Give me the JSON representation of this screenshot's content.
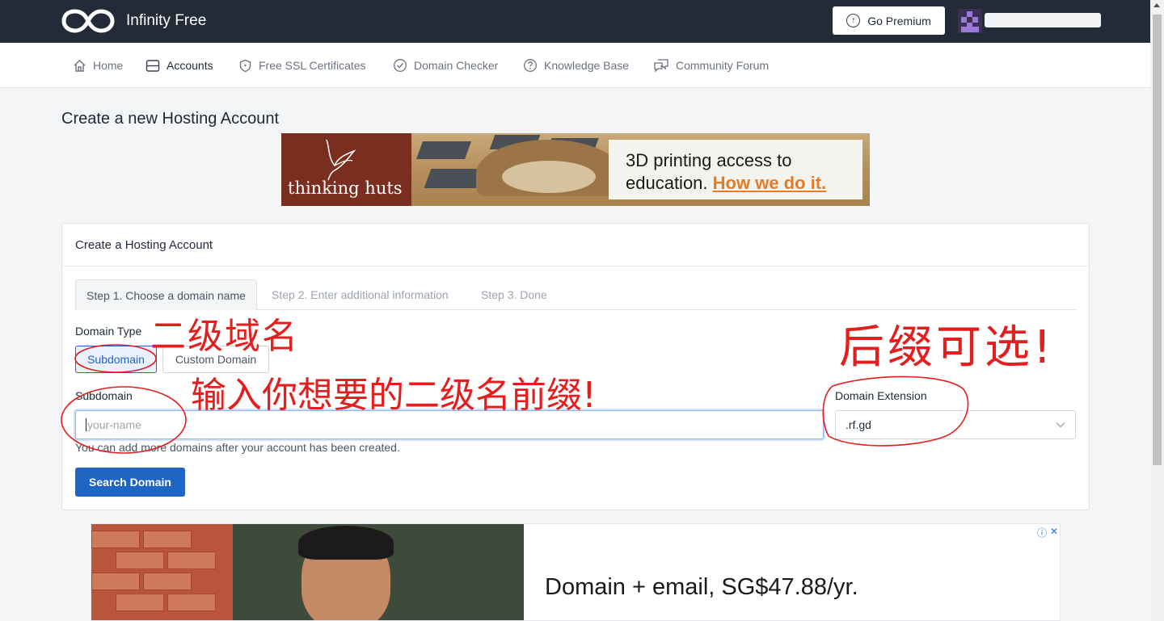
{
  "header": {
    "brand": "Infinity Free",
    "premium_label": "Go Premium"
  },
  "nav": {
    "items": [
      {
        "label": "Home",
        "icon": "home-icon"
      },
      {
        "label": "Accounts",
        "icon": "accounts-icon"
      },
      {
        "label": "Free SSL Certificates",
        "icon": "shield-icon"
      },
      {
        "label": "Domain Checker",
        "icon": "check-circle-icon"
      },
      {
        "label": "Knowledge Base",
        "icon": "question-circle-icon"
      },
      {
        "label": "Community Forum",
        "icon": "chat-icon"
      }
    ],
    "active": "Accounts"
  },
  "page": {
    "title": "Create a new Hosting Account"
  },
  "banner_ad": {
    "brand": "thinking huts",
    "line1": "3D printing access to",
    "line2": "education.",
    "cta": "How we do it."
  },
  "card": {
    "title": "Create a Hosting Account",
    "tabs": [
      {
        "label": "Step 1. Choose a domain name",
        "active": true
      },
      {
        "label": "Step 2. Enter additional information",
        "active": false
      },
      {
        "label": "Step 3. Done",
        "active": false
      }
    ],
    "domain_type_label": "Domain Type",
    "domain_types": [
      "Subdomain",
      "Custom Domain"
    ],
    "selected_domain_type": "Subdomain",
    "subdomain_label": "Subdomain",
    "subdomain_placeholder": "your-name",
    "extension_label": "Domain Extension",
    "extension_value": ".rf.gd",
    "help_text": "You can add more domains after your account has been created.",
    "search_button": "Search Domain"
  },
  "bottom_ad": {
    "headline": "Domain + email, SG$47.88/yr."
  },
  "annotations": {
    "domain_type_note": "二级域名",
    "subdomain_note": "输入你想要的二级名前缀!",
    "extension_note": "后缀可选!"
  },
  "colors": {
    "topbar": "#232b38",
    "primary": "#1f65c3",
    "annotation": "#e41d1d"
  }
}
